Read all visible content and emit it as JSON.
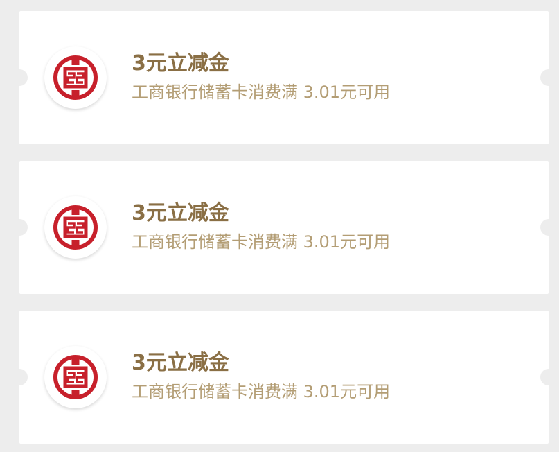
{
  "coupons": [
    {
      "title": "3元立减金",
      "description": "工商银行储蓄卡消费满 3.01元可用",
      "icon": "icbc-logo-icon"
    },
    {
      "title": "3元立减金",
      "description": "工商银行储蓄卡消费满 3.01元可用",
      "icon": "icbc-logo-icon"
    },
    {
      "title": "3元立减金",
      "description": "工商银行储蓄卡消费满 3.01元可用",
      "icon": "icbc-logo-icon"
    }
  ],
  "colors": {
    "background": "#ededed",
    "card": "#ffffff",
    "title": "#8a6f45",
    "description": "#b39d74",
    "logo_red": "#c7202b"
  }
}
